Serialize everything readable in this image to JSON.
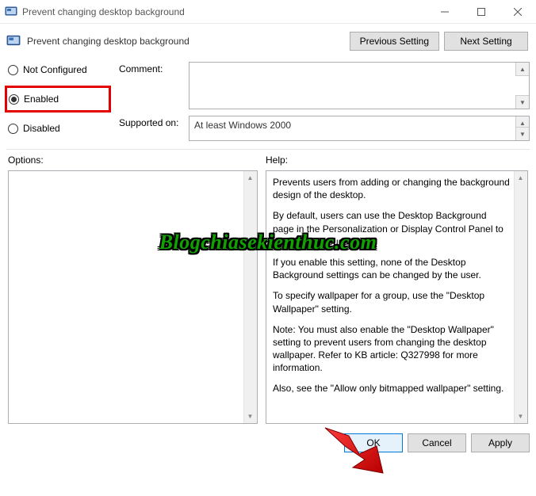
{
  "window": {
    "title": "Prevent changing desktop background"
  },
  "header": {
    "title": "Prevent changing desktop background",
    "prev": "Previous Setting",
    "next": "Next Setting"
  },
  "radios": {
    "not_configured": "Not Configured",
    "enabled": "Enabled",
    "disabled": "Disabled"
  },
  "fields": {
    "comment_label": "Comment:",
    "comment_value": "",
    "supported_label": "Supported on:",
    "supported_value": "At least Windows 2000"
  },
  "labels": {
    "options": "Options:",
    "help": "Help:"
  },
  "help": {
    "p1": "Prevents users from adding or changing the background design of the desktop.",
    "p2": "By default, users can use the Desktop Background page in the Personalization or Display Control Panel to add a background",
    "p3": "If you enable this setting, none of the Desktop Background settings can be changed by the user.",
    "p4": "To specify wallpaper for a group, use the \"Desktop Wallpaper\" setting.",
    "p5": "Note: You must also enable the \"Desktop Wallpaper\" setting to prevent users from changing the desktop wallpaper. Refer to KB article: Q327998 for more information.",
    "p6": "Also, see the \"Allow only bitmapped wallpaper\" setting."
  },
  "footer": {
    "ok": "OK",
    "cancel": "Cancel",
    "apply": "Apply"
  },
  "watermark": "Blogchiasekienthuc.com"
}
